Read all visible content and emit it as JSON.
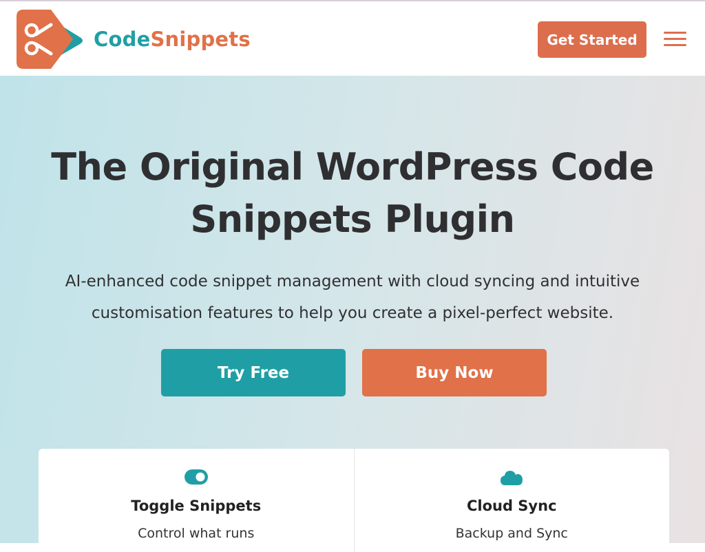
{
  "header": {
    "logo_text_part1": "Code",
    "logo_text_part2": "Snippets",
    "get_started_label": "Get Started"
  },
  "hero": {
    "title_line1": "The Original WordPress Code",
    "title_line2": "Snippets Plugin",
    "subtitle_line1": "AI-enhanced code snippet management with cloud syncing and intuitive",
    "subtitle_line2": "customisation features to help you create a pixel-perfect website.",
    "try_free_label": "Try Free",
    "buy_now_label": "Buy Now"
  },
  "features": [
    {
      "icon": "toggle-icon",
      "title": "Toggle Snippets",
      "description": "Control what runs"
    },
    {
      "icon": "cloud-icon",
      "title": "Cloud Sync",
      "description": "Backup and Sync"
    }
  ],
  "colors": {
    "teal": "#1f9fa5",
    "orange": "#e07148"
  }
}
